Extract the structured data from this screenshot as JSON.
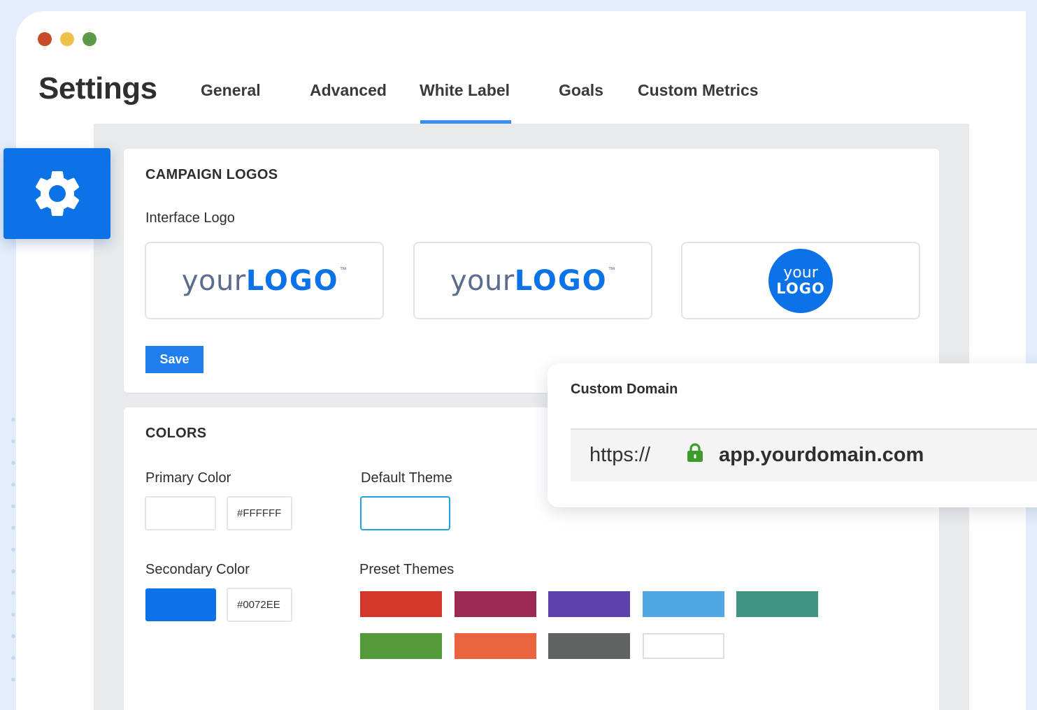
{
  "window": {
    "title": "Settings",
    "tabs": [
      {
        "label": "General",
        "active": false
      },
      {
        "label": "Advanced",
        "active": false
      },
      {
        "label": "White Label",
        "active": true
      },
      {
        "label": "Goals",
        "active": false
      },
      {
        "label": "Custom Metrics",
        "active": false
      }
    ]
  },
  "sidebar": {
    "icon": "gear-icon"
  },
  "campaign_logos": {
    "section_title": "CAMPAIGN LOGOS",
    "interface_logo_label": "Interface Logo",
    "logos": [
      {
        "your": "your",
        "logo": "LOGO",
        "tm": "™"
      },
      {
        "your": "your",
        "logo": "LOGO",
        "tm": "™"
      },
      {
        "your": "your",
        "logo": "LOGO"
      }
    ],
    "save_label": "Save"
  },
  "colors": {
    "section_title": "COLORS",
    "primary_label": "Primary Color",
    "primary_hex": "#FFFFFF",
    "secondary_label": "Secondary Color",
    "secondary_hex": "#0072EE",
    "default_theme_label": "Default Theme",
    "preset_themes_label": "Preset Themes",
    "presets": [
      "#d1382a",
      "#9a2a52",
      "#5e42ab",
      "#51a6e6",
      "#3f9483",
      "#529a3a",
      "#e9643f",
      "#616262",
      "#ffffff"
    ]
  },
  "custom_domain": {
    "title": "Custom Domain",
    "protocol": "https://",
    "host": "app.yourdomain.com",
    "lock_icon": "lock-icon"
  },
  "accent_color": "#0C73E6"
}
